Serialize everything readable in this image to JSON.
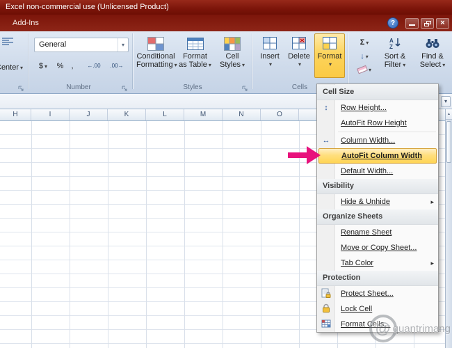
{
  "window": {
    "title": "Excel non-commercial use (Unlicensed Product)",
    "active_tab": "Add-Ins"
  },
  "ribbon": {
    "alignment_group": {
      "center_button": "Center"
    },
    "number_group": {
      "format_value": "General",
      "currency_label": "$",
      "percent_label": "%",
      "comma_label": ",",
      "group_label": "Number"
    },
    "styles_group": {
      "conditional_line1": "Conditional",
      "conditional_line2": "Formatting",
      "table_line1": "Format",
      "table_line2": "as Table",
      "cellstyles_line1": "Cell",
      "cellstyles_line2": "Styles",
      "group_label": "Styles"
    },
    "cells_group": {
      "insert_label": "Insert",
      "delete_label": "Delete",
      "format_label": "Format",
      "group_label": "Cells"
    },
    "editing_group": {
      "sort_line1": "Sort &",
      "sort_line2": "Filter",
      "find_line1": "Find &",
      "find_line2": "Select"
    }
  },
  "menu": {
    "sections": [
      {
        "header": "Cell Size",
        "items": [
          {
            "label": "Row Height..."
          },
          {
            "label": "AutoFit Row Height"
          },
          {
            "label": "Column Width..."
          },
          {
            "label": "AutoFit Column Width"
          },
          {
            "label": "Default Width..."
          }
        ]
      },
      {
        "header": "Visibility",
        "items": [
          {
            "label": "Hide & Unhide"
          }
        ]
      },
      {
        "header": "Organize Sheets",
        "items": [
          {
            "label": "Rename Sheet"
          },
          {
            "label": "Move or Copy Sheet..."
          },
          {
            "label": "Tab Color"
          }
        ]
      },
      {
        "header": "Protection",
        "items": [
          {
            "label": "Protect Sheet..."
          },
          {
            "label": "Lock Cell"
          },
          {
            "label": "Format Cells..."
          }
        ]
      }
    ]
  },
  "sheet": {
    "columns": [
      "H",
      "I",
      "J",
      "K",
      "L",
      "M",
      "N",
      "O"
    ]
  },
  "watermark": {
    "logo": "@",
    "text": "quantrimang"
  },
  "icons": {
    "help": "?",
    "close": "×",
    "dropdown": "▾",
    "submenu": "▸",
    "sigma": "Σ",
    "fill": "↓",
    "row_height": "↕",
    "column_width": "↔",
    "increase_decimal": "←.00",
    "decrease_decimal": ".00→",
    "formula_expand": "▾",
    "scroll_up": "▴"
  },
  "colors": {
    "title_bar": "#7c150a",
    "format_button_highlight": "#fcd45c",
    "menu_highlight": "#ffdf7e",
    "callout_arrow": "#e8127c"
  }
}
